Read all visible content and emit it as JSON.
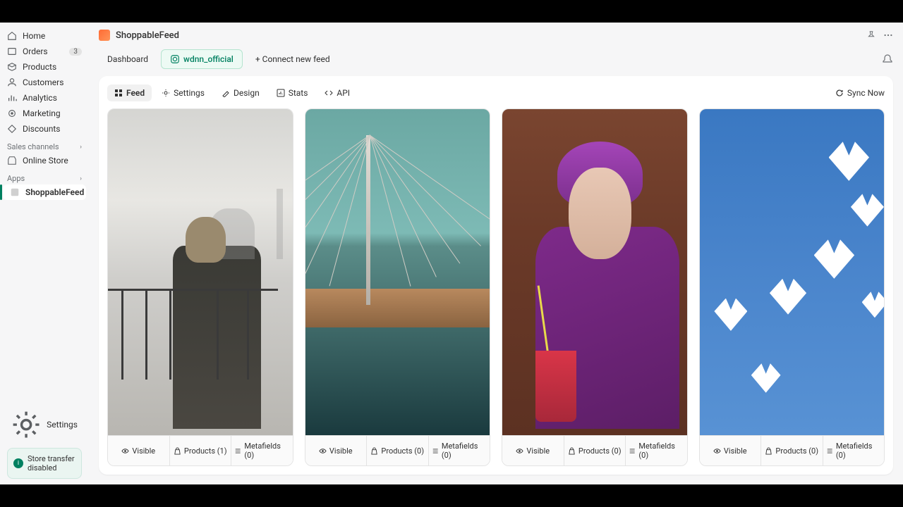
{
  "breadcrumb": {
    "title": "ShoppableFeed"
  },
  "sidebar": {
    "items": [
      {
        "label": "Home"
      },
      {
        "label": "Orders",
        "badge": "3"
      },
      {
        "label": "Products"
      },
      {
        "label": "Customers"
      },
      {
        "label": "Analytics"
      },
      {
        "label": "Marketing"
      },
      {
        "label": "Discounts"
      }
    ],
    "sales_channels_label": "Sales channels",
    "online_store_label": "Online Store",
    "apps_label": "Apps",
    "app_item_label": "ShoppableFeed",
    "settings_label": "Settings",
    "alert_text": "Store transfer disabled"
  },
  "tabs": {
    "dashboard": "Dashboard",
    "feed_chip": "wdnn_official",
    "connect": "+ Connect new feed"
  },
  "content_tabs": {
    "feed": "Feed",
    "settings": "Settings",
    "design": "Design",
    "stats": "Stats",
    "api": "API",
    "sync": "Sync Now"
  },
  "cards": [
    {
      "visible": "Visible",
      "products": "Products (1)",
      "metafields": "Metafields (0)"
    },
    {
      "visible": "Visible",
      "products": "Products (0)",
      "metafields": "Metafields (0)"
    },
    {
      "visible": "Visible",
      "products": "Products (0)",
      "metafields": "Metafields (0)"
    },
    {
      "visible": "Visible",
      "products": "Products (0)",
      "metafields": "Metafields (0)"
    }
  ]
}
